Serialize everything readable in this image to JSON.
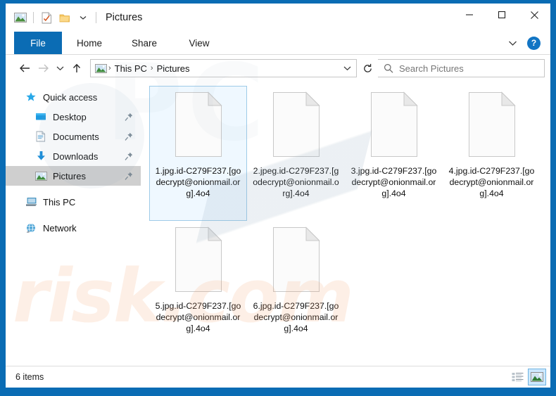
{
  "window": {
    "title": "Pictures",
    "quick_access_toolbar": [
      {
        "name": "picture-folder-icon",
        "label": "Pictures"
      },
      {
        "name": "properties-icon",
        "label": "Properties"
      },
      {
        "name": "new-folder-icon",
        "label": "New folder"
      },
      {
        "name": "customize-dropdown-icon",
        "label": "Customize Quick Access Toolbar"
      }
    ],
    "controls": {
      "minimize": "Minimize",
      "maximize": "Maximize",
      "close": "Close"
    }
  },
  "ribbon": {
    "tabs": [
      {
        "label": "File",
        "active": true
      },
      {
        "label": "Home",
        "active": false
      },
      {
        "label": "Share",
        "active": false
      },
      {
        "label": "View",
        "active": false
      }
    ],
    "collapse_label": "Minimize the Ribbon",
    "help_label": "?"
  },
  "navigation": {
    "back": "Back",
    "forward": "Forward",
    "recent": "Recent locations",
    "up": "Up",
    "refresh": "Refresh",
    "breadcrumb": [
      "This PC",
      "Pictures"
    ],
    "breadcrumb_separator": "›",
    "address_dropdown": "Previous locations"
  },
  "search": {
    "placeholder": "Search Pictures",
    "value": ""
  },
  "sidebar": {
    "items": [
      {
        "label": "Quick access",
        "icon": "star-icon",
        "level": "root",
        "selected": false,
        "pinned": false
      },
      {
        "label": "Desktop",
        "icon": "desktop-icon",
        "level": "child",
        "selected": false,
        "pinned": true
      },
      {
        "label": "Documents",
        "icon": "documents-icon",
        "level": "child",
        "selected": false,
        "pinned": true
      },
      {
        "label": "Downloads",
        "icon": "downloads-icon",
        "level": "child",
        "selected": false,
        "pinned": true
      },
      {
        "label": "Pictures",
        "icon": "pictures-icon",
        "level": "child",
        "selected": true,
        "pinned": true
      },
      {
        "label": "This PC",
        "icon": "this-pc-icon",
        "level": "root",
        "selected": false,
        "pinned": false
      },
      {
        "label": "Network",
        "icon": "network-icon",
        "level": "root",
        "selected": false,
        "pinned": false
      }
    ]
  },
  "files": [
    {
      "name": "1.jpg.id-C279F237.[godecrypt@onionmail.org].4o4",
      "selected": true,
      "icon": "blank-file-icon"
    },
    {
      "name": "2.jpeg.id-C279F237.[godecrypt@onionmail.org].4o4",
      "selected": false,
      "icon": "blank-file-icon"
    },
    {
      "name": "3.jpg.id-C279F237.[godecrypt@onionmail.org].4o4",
      "selected": false,
      "icon": "blank-file-icon"
    },
    {
      "name": "4.jpg.id-C279F237.[godecrypt@onionmail.org].4o4",
      "selected": false,
      "icon": "blank-file-icon"
    },
    {
      "name": "5.jpg.id-C279F237.[godecrypt@onionmail.org].4o4",
      "selected": false,
      "icon": "blank-file-icon"
    },
    {
      "name": "6.jpg.id-C279F237.[godecrypt@onionmail.org].4o4",
      "selected": false,
      "icon": "blank-file-icon"
    }
  ],
  "status": {
    "item_count": "6 items",
    "views": [
      {
        "name": "details-view-button",
        "label": "Details view",
        "active": false
      },
      {
        "name": "large-icons-view-button",
        "label": "Large icons view",
        "active": true
      }
    ]
  },
  "watermark": {
    "bottom_text": "risk.com",
    "top_text": "PC"
  },
  "colors": {
    "accent": "#0b6cb4",
    "frame": "#0a6cb4",
    "selection": "#cce8ff",
    "selection_border": "#9ecbe8",
    "sidebar_selected": "#cfcfcf",
    "watermark": "#f6a06a"
  }
}
